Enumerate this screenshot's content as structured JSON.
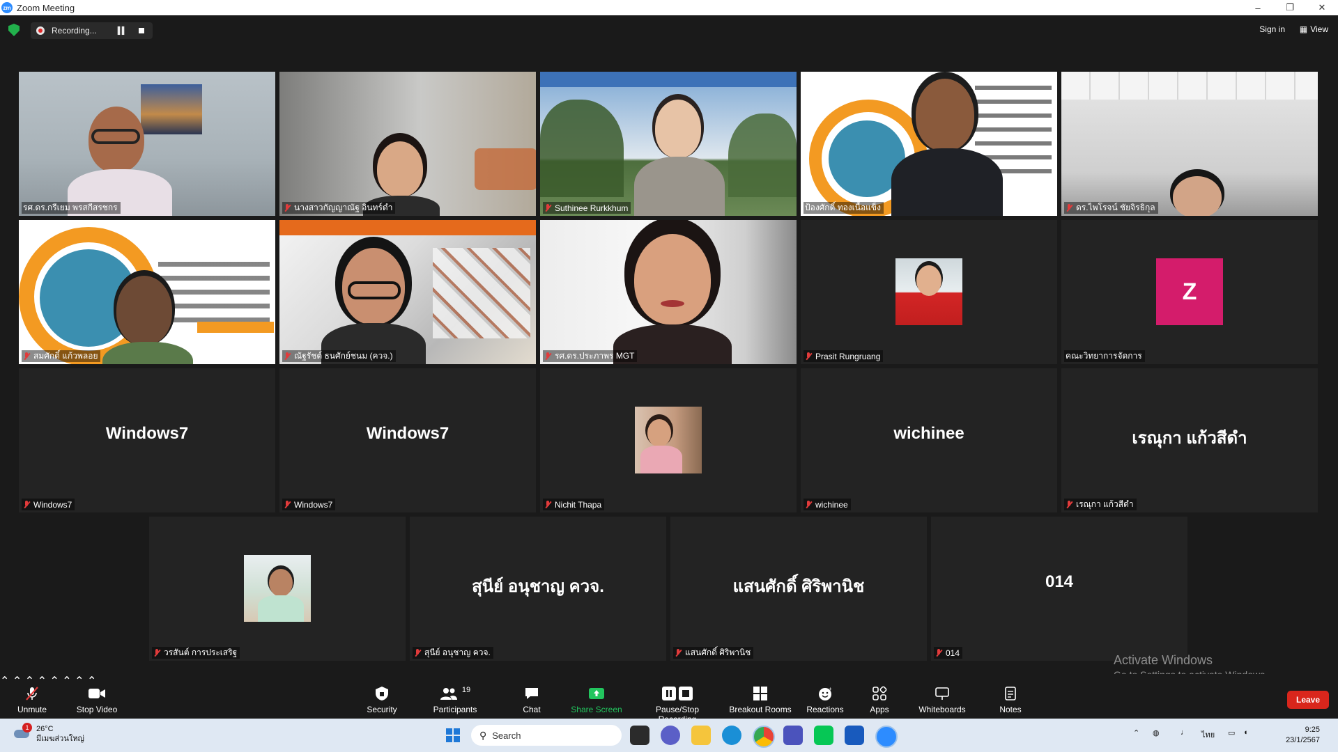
{
  "window": {
    "title": "Zoom Meeting",
    "controls": [
      "–",
      "❐",
      "✕"
    ]
  },
  "top_bar": {
    "recording_label": "Recording...",
    "sign_in": "Sign in",
    "view": "View"
  },
  "tiles": [
    {
      "name": "รศ.ดร.กรีเยม พรสกีสรชกร",
      "kind": "video",
      "active": true
    },
    {
      "name": "นางสาวกัญญาณัฐ อินทร์ดำ",
      "kind": "video"
    },
    {
      "name": "Suthinee Rurkkhum",
      "kind": "video"
    },
    {
      "name": "ป้องศักดิ์ ทองเนื้อแข็ง",
      "kind": "video"
    },
    {
      "name": "ดร.ไพโรจน์ ชัยจิรธิกุล",
      "kind": "video"
    },
    {
      "name": "สมศักดิ์ แก้วพลอย",
      "kind": "video"
    },
    {
      "name": "ณัฐรัชต์ ธนศักย์ชนม (ควจ.)",
      "kind": "video"
    },
    {
      "name": "รศ.ดร.ประภาพร MGT",
      "kind": "video"
    },
    {
      "name": "Prasit Rungruang",
      "kind": "photo"
    },
    {
      "name": "คณะวิทยาการจัดการ",
      "kind": "avatar",
      "letter": "Z",
      "color": "#d41c6b"
    },
    {
      "name": "Windows7",
      "kind": "text",
      "display": "Windows7"
    },
    {
      "name": "Windows7",
      "kind": "text",
      "display": "Windows7"
    },
    {
      "name": "Nichit Thapa",
      "kind": "photo"
    },
    {
      "name": "wichinee",
      "kind": "text",
      "display": "wichinee"
    },
    {
      "name": "เรณุกา แก้วสีดำ",
      "kind": "text",
      "display": "เรณุกา แก้วสีดำ"
    },
    {
      "name": "วรสันต์ การประเสริฐ",
      "kind": "photo"
    },
    {
      "name": "สุนีย์ อนุชาญ ควจ.",
      "kind": "text",
      "display": "สุนีย์ อนุชาญ ควจ."
    },
    {
      "name": "แสนศักดิ์ ศิริพานิช",
      "kind": "text",
      "display": "แสนศักดิ์ ศิริพานิช"
    },
    {
      "name": "014",
      "kind": "text",
      "display": "014"
    }
  ],
  "watermark": {
    "line1": "Activate Windows",
    "line2": "Go to Settings to activate Windows."
  },
  "toolbar": {
    "unmute": "Unmute",
    "stop_video": "Stop Video",
    "security": "Security",
    "participants": "Participants",
    "participants_count": "19",
    "chat": "Chat",
    "share_screen": "Share Screen",
    "pause_recording": "Pause/Stop Recording",
    "breakout": "Breakout Rooms",
    "reactions": "Reactions",
    "apps": "Apps",
    "whiteboards": "Whiteboards",
    "notes": "Notes",
    "leave": "Leave",
    "share_color": "#22c55e",
    "leave_color": "#d9261c"
  },
  "taskbar": {
    "temperature": "26°C",
    "weather_text": "มีเมฆส่วนใหญ่",
    "weather_badge": "1",
    "search": "Search",
    "lang": "ไทย",
    "time": "9:25",
    "date": "23/1/2567"
  }
}
